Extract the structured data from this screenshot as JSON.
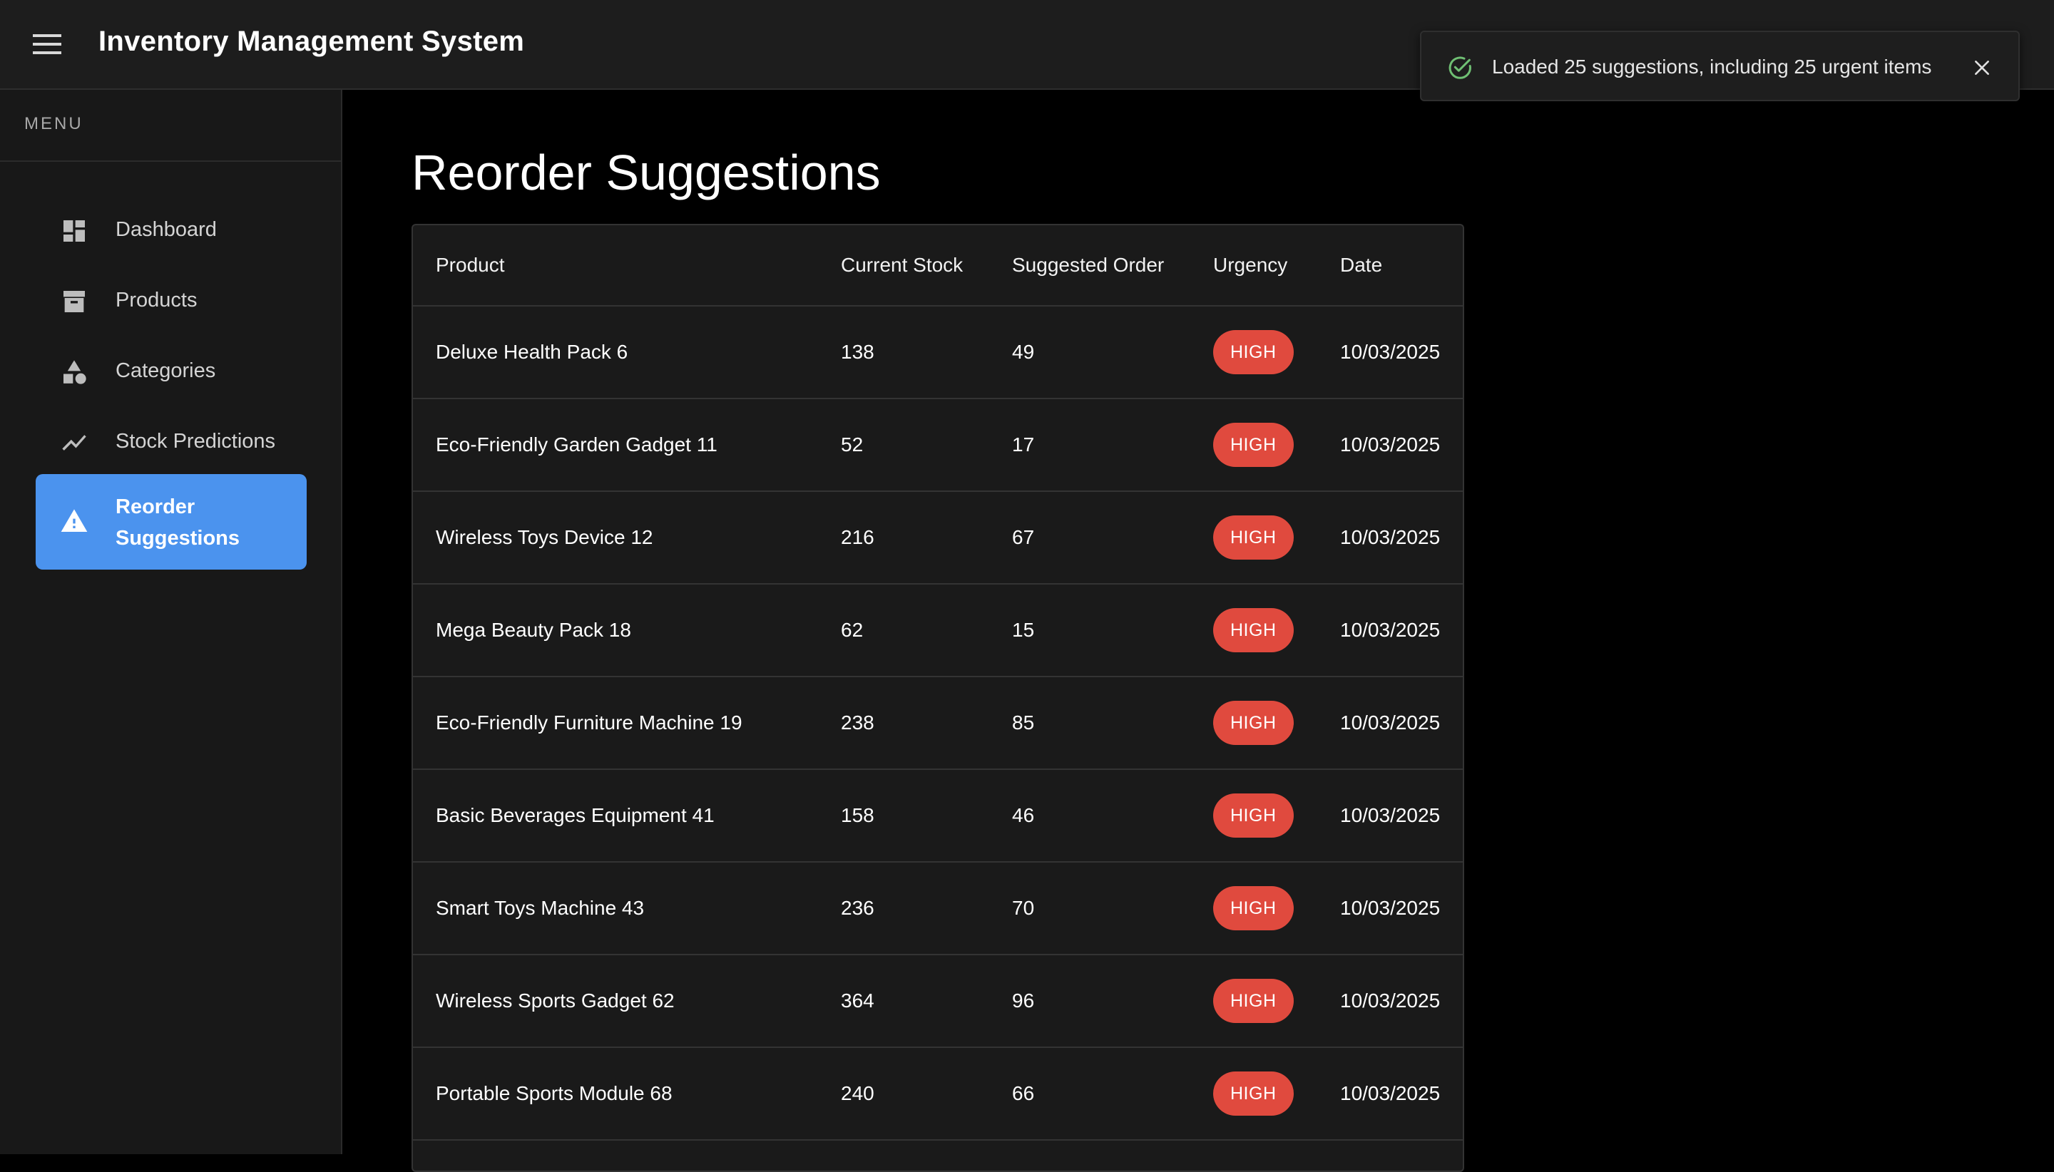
{
  "app": {
    "title": "Inventory Management System"
  },
  "toast": {
    "message": "Loaded 25 suggestions, including 25 urgent items",
    "icon": "check-circle-icon",
    "icon_color": "#6fbf73"
  },
  "sidebar": {
    "menu_label": "MENU",
    "items": [
      {
        "label": "Dashboard",
        "icon": "dashboard-icon",
        "active": false
      },
      {
        "label": "Products",
        "icon": "archive-box-icon",
        "active": false
      },
      {
        "label": "Categories",
        "icon": "category-shapes-icon",
        "active": false
      },
      {
        "label": "Stock Predictions",
        "icon": "trending-line-icon",
        "active": false
      },
      {
        "label": "Reorder Suggestions",
        "icon": "warning-icon",
        "active": true
      }
    ],
    "active_color": "#4b93ee"
  },
  "main": {
    "title": "Reorder Suggestions",
    "table": {
      "columns": [
        "Product",
        "Current Stock",
        "Suggested Order",
        "Urgency",
        "Date"
      ],
      "rows": [
        {
          "product": "Deluxe Health Pack 6",
          "stock": "138",
          "order": "49",
          "urgency": "HIGH",
          "date": "10/03/2025"
        },
        {
          "product": "Eco-Friendly Garden Gadget 11",
          "stock": "52",
          "order": "17",
          "urgency": "HIGH",
          "date": "10/03/2025"
        },
        {
          "product": "Wireless Toys Device 12",
          "stock": "216",
          "order": "67",
          "urgency": "HIGH",
          "date": "10/03/2025"
        },
        {
          "product": "Mega Beauty Pack 18",
          "stock": "62",
          "order": "15",
          "urgency": "HIGH",
          "date": "10/03/2025"
        },
        {
          "product": "Eco-Friendly Furniture Machine 19",
          "stock": "238",
          "order": "85",
          "urgency": "HIGH",
          "date": "10/03/2025"
        },
        {
          "product": "Basic Beverages Equipment 41",
          "stock": "158",
          "order": "46",
          "urgency": "HIGH",
          "date": "10/03/2025"
        },
        {
          "product": "Smart Toys Machine 43",
          "stock": "236",
          "order": "70",
          "urgency": "HIGH",
          "date": "10/03/2025"
        },
        {
          "product": "Wireless Sports Gadget 62",
          "stock": "364",
          "order": "96",
          "urgency": "HIGH",
          "date": "10/03/2025"
        },
        {
          "product": "Portable Sports Module 68",
          "stock": "240",
          "order": "66",
          "urgency": "HIGH",
          "date": "10/03/2025"
        }
      ]
    },
    "urgency_color": "#e04a3e"
  }
}
